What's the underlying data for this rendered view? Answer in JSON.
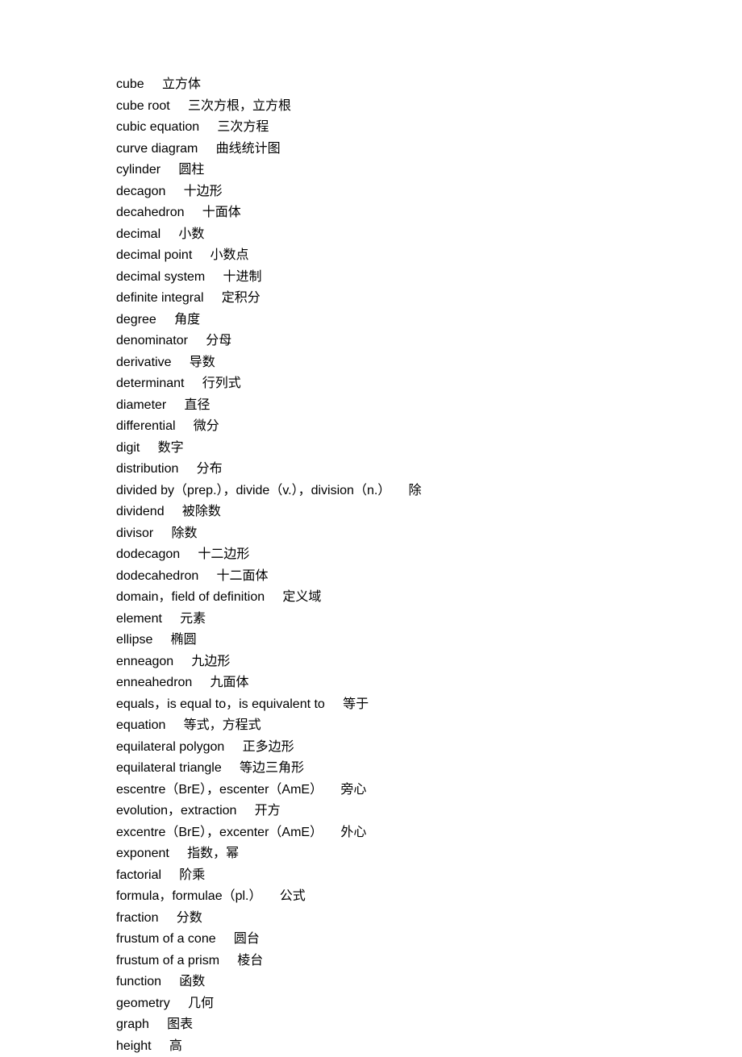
{
  "entries": [
    {
      "term": "cube",
      "definition": "立方体"
    },
    {
      "term": "cube root",
      "definition": "三次方根，立方根"
    },
    {
      "term": "cubic equation",
      "definition": "三次方程"
    },
    {
      "term": "curve diagram",
      "definition": "曲线统计图"
    },
    {
      "term": "cylinder",
      "definition": "圆柱"
    },
    {
      "term": "decagon",
      "definition": "十边形"
    },
    {
      "term": "decahedron",
      "definition": "十面体"
    },
    {
      "term": "decimal",
      "definition": "小数"
    },
    {
      "term": "decimal point",
      "definition": "小数点"
    },
    {
      "term": "decimal system",
      "definition": "十进制"
    },
    {
      "term": "definite integral",
      "definition": "定积分"
    },
    {
      "term": "degree",
      "definition": "角度"
    },
    {
      "term": "denominator",
      "definition": "分母"
    },
    {
      "term": "derivative",
      "definition": "导数"
    },
    {
      "term": "determinant",
      "definition": "行列式"
    },
    {
      "term": "diameter",
      "definition": "直径"
    },
    {
      "term": "differential",
      "definition": "微分"
    },
    {
      "term": "digit",
      "definition": "数字"
    },
    {
      "term": "distribution",
      "definition": "分布"
    },
    {
      "term": "divided by（prep.），divide（v.），division（n.）",
      "definition": "除"
    },
    {
      "term": "dividend",
      "definition": "被除数"
    },
    {
      "term": "divisor",
      "definition": "除数"
    },
    {
      "term": "dodecagon",
      "definition": "十二边形"
    },
    {
      "term": "dodecahedron",
      "definition": "十二面体"
    },
    {
      "term": "domain，field of definition",
      "definition": "定义域"
    },
    {
      "term": "element",
      "definition": "元素"
    },
    {
      "term": "ellipse",
      "definition": "椭圆"
    },
    {
      "term": "enneagon",
      "definition": "九边形"
    },
    {
      "term": "enneahedron",
      "definition": "九面体"
    },
    {
      "term": "equals，is equal to，is equivalent to",
      "definition": "等于"
    },
    {
      "term": "equation",
      "definition": "等式，方程式"
    },
    {
      "term": "equilateral polygon",
      "definition": "正多边形"
    },
    {
      "term": "equilateral triangle",
      "definition": "等边三角形"
    },
    {
      "term": "escentre（BrE），escenter（AmE）",
      "definition": "旁心"
    },
    {
      "term": "evolution，extraction",
      "definition": "开方"
    },
    {
      "term": "excentre（BrE），excenter（AmE）",
      "definition": "外心"
    },
    {
      "term": "exponent",
      "definition": "指数，幂"
    },
    {
      "term": "factorial",
      "definition": "阶乘"
    },
    {
      "term": "formula，formulae（pl.）",
      "definition": "公式"
    },
    {
      "term": "fraction",
      "definition": "分数"
    },
    {
      "term": "frustum of a cone",
      "definition": "圆台"
    },
    {
      "term": "frustum of a prism",
      "definition": "棱台"
    },
    {
      "term": "function",
      "definition": "函数"
    },
    {
      "term": "geometry",
      "definition": "几何"
    },
    {
      "term": "graph",
      "definition": "图表"
    },
    {
      "term": "height",
      "definition": "高"
    }
  ],
  "separator": "     "
}
